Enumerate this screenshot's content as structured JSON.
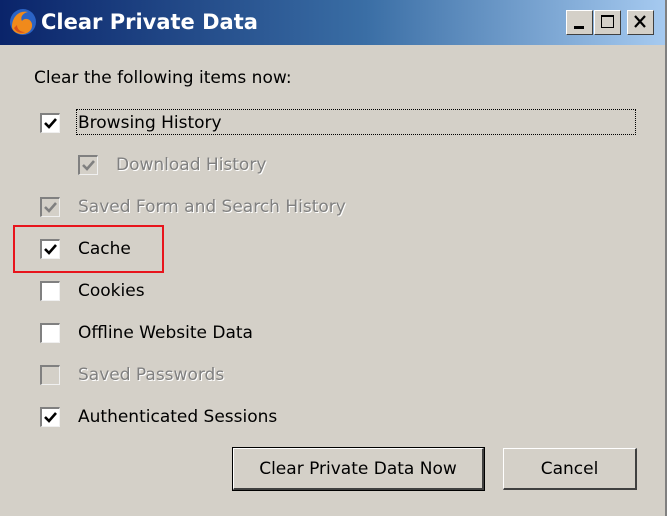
{
  "window": {
    "title": "Clear Private Data",
    "app_icon": "firefox-icon",
    "controls": [
      "minimize-icon",
      "maximize-icon",
      "close-icon"
    ]
  },
  "intro_text": "Clear the following items now:",
  "options": [
    {
      "label": "Browsing History",
      "checked": true,
      "enabled": true,
      "focused": true
    },
    {
      "label": "Download History",
      "checked": true,
      "enabled": false
    },
    {
      "label": "Saved Form and Search History",
      "checked": true,
      "enabled": false
    },
    {
      "label": "Cache",
      "checked": true,
      "enabled": true,
      "highlighted": true
    },
    {
      "label": "Cookies",
      "checked": false,
      "enabled": true
    },
    {
      "label": "Offline Website Data",
      "checked": false,
      "enabled": true
    },
    {
      "label": "Saved Passwords",
      "checked": false,
      "enabled": false
    },
    {
      "label": "Authenticated Sessions",
      "checked": true,
      "enabled": true
    }
  ],
  "buttons": {
    "clear_now": "Clear Private Data Now",
    "cancel": "Cancel"
  },
  "colors": {
    "dialog_bg": "#d4d0c8",
    "titlebar_start": "#0a246a",
    "titlebar_end": "#a6caf0",
    "highlight_border": "#e8141c",
    "disabled_text": "#808080"
  }
}
